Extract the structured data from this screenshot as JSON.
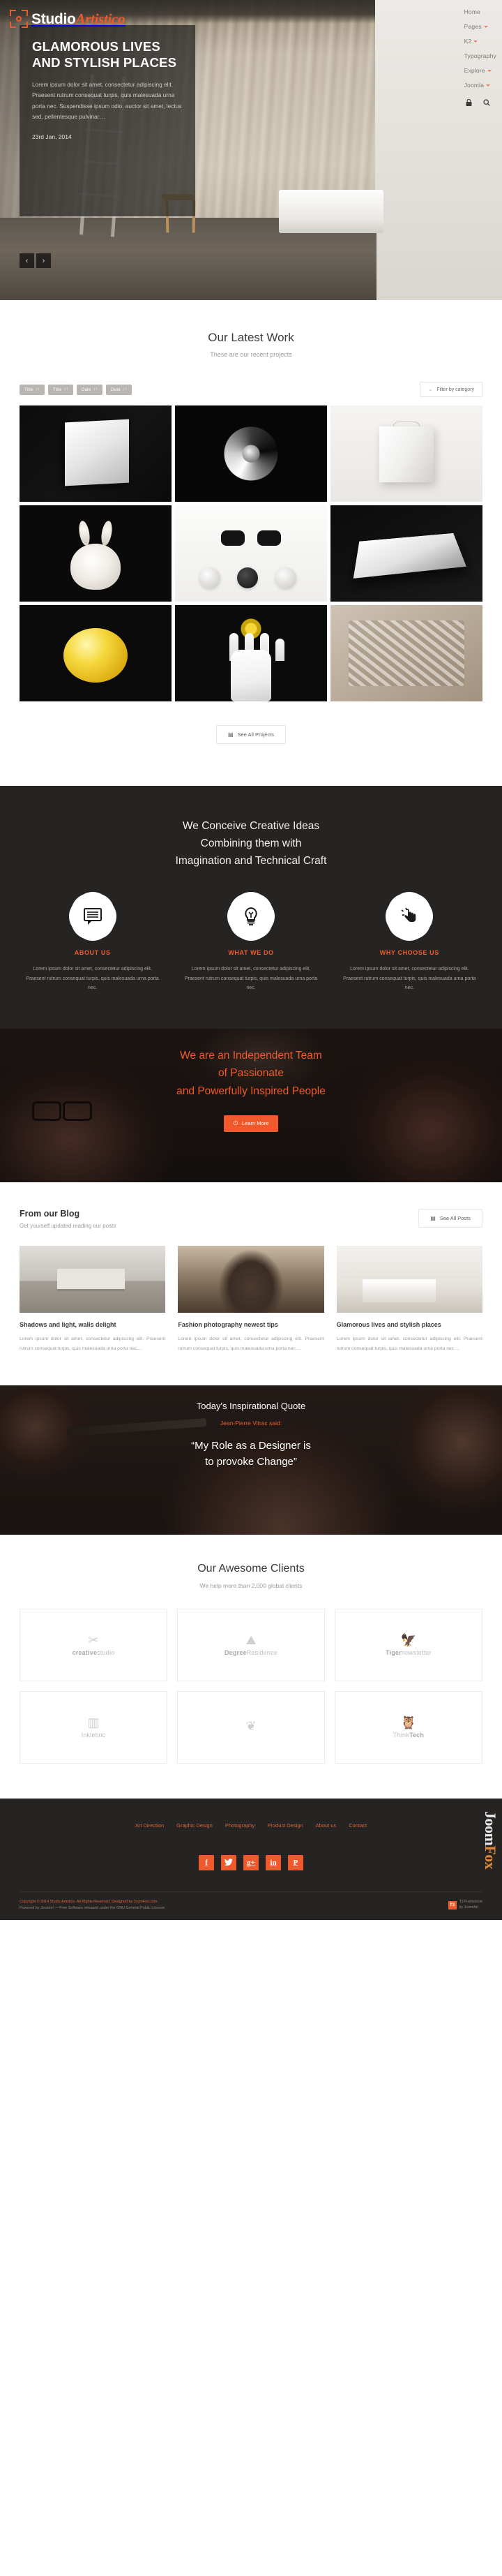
{
  "brand": {
    "name_part1": "Studio",
    "name_part2": "Artistico"
  },
  "nav": {
    "items": [
      {
        "label": "Home",
        "has_dropdown": false
      },
      {
        "label": "Pages",
        "has_dropdown": true
      },
      {
        "label": "K2",
        "has_dropdown": true
      },
      {
        "label": "Typography",
        "has_dropdown": false
      },
      {
        "label": "Explore",
        "has_dropdown": true
      },
      {
        "label": "Joomla",
        "has_dropdown": true
      }
    ],
    "icons": [
      {
        "name": "lock-icon",
        "glyph": "🔒"
      },
      {
        "name": "search-icon",
        "glyph": "🔍"
      }
    ]
  },
  "hero": {
    "title": "GLAMOROUS LIVES AND STYLISH PLACES",
    "body": "Lorem ipsum dolor sit amet, consectetur adipiscing elit. Praesent rutrum consequat turpis, quis malesuada urna porta nec. Suspendisse ipsum odio, auctor sit amet, lectus sed, pellentesque pulvinar…",
    "date": "23rd Jan, 2014",
    "prev_label": "‹",
    "next_label": "›"
  },
  "latest_work": {
    "title": "Our Latest Work",
    "subtitle": "These are our recent projects",
    "sorters": [
      {
        "label": "Title",
        "arrow": "↓↑"
      },
      {
        "label": "Title",
        "arrow": "↓↑"
      },
      {
        "label": "Date",
        "arrow": "↓↑"
      },
      {
        "label": "Date",
        "arrow": "↓↑"
      }
    ],
    "filter_label": "Filter by category",
    "see_all_label": "See All Projects",
    "tiles": [
      {
        "name": "folded-paper"
      },
      {
        "name": "spiral-shell"
      },
      {
        "name": "paper-bag"
      },
      {
        "name": "plush-bunny"
      },
      {
        "name": "glasses-lenses"
      },
      {
        "name": "open-book"
      },
      {
        "name": "yellow-lemon"
      },
      {
        "name": "hand-flower"
      },
      {
        "name": "crumpled-fabric"
      }
    ]
  },
  "ideas": {
    "heading_line1": "We Conceive Creative Ideas",
    "heading_line2": "Combining them with",
    "heading_line3": "Imagination and Technical Craft",
    "features": [
      {
        "icon": "speech-bubble-icon",
        "title": "ABOUT US",
        "body": "Lorem ipsum dolor sit amet, consectetur adipiscing elit. Praesent rutrum consequat turpis, quis malesuada urna porta nec."
      },
      {
        "icon": "lightbulb-icon",
        "title": "WHAT WE DO",
        "body": "Lorem ipsum dolor sit amet, consectetur adipiscing elit. Praesent rutrum consequat turpis, quis malesuada urna porta nec."
      },
      {
        "icon": "click-hand-icon",
        "title": "WHY CHOOSE US",
        "body": "Lorem ipsum dolor sit amet, consectetur adipiscing elit. Praesent rutrum consequat turpis, quis malesuada urna porta nec."
      }
    ]
  },
  "team_parallax": {
    "line1": "We are an Independent Team",
    "line2": "of Passionate",
    "line3": "and Powerfully Inspired People",
    "button_label": "Learn More"
  },
  "blog": {
    "title": "From our Blog",
    "subtitle": "Get yourself updated reading our posts",
    "see_all_label": "See All Posts",
    "posts": [
      {
        "title": "Shadows and light, walls delight",
        "excerpt": "Lorem ipsum dolor sit amet, consectetur adipiscing elit. Praesent rutrum consequat turpis, quis malesuada urna porta nec.…"
      },
      {
        "title": "Fashion photography newest tips",
        "excerpt": "Lorem ipsum dolor sit amet, consectetur adipiscing elit. Praesent rutrum consequat turpis, quis malesuada urna porta nec.…"
      },
      {
        "title": "Glamorous lives and stylish places",
        "excerpt": "Lorem ipsum dolor sit amet, consectetur adipiscing elit. Praesent rutrum consequat turpis, quis malesuada urna porta nec.…"
      }
    ]
  },
  "quote": {
    "title": "Today's Inspirational Quote",
    "author": "Jean-Pierre Vitrac said:",
    "text_line1": "“My Role as a Designer is",
    "text_line2": "to provoke Change”"
  },
  "clients": {
    "title": "Our Awesome Clients",
    "subtitle": "We help more than 2,000 global clients",
    "items": [
      {
        "glyph": "✂",
        "name_bold": "creative",
        "name_rest": "studio"
      },
      {
        "glyph": "⛰",
        "name_bold": "Degree",
        "name_rest": "Residence"
      },
      {
        "glyph": "🦅",
        "name_bold": "Tiger",
        "name_rest": "nowsletter"
      },
      {
        "glyph": "▥",
        "name_bold": "",
        "name_rest": "Inkletinc"
      },
      {
        "glyph": "❦",
        "name_bold": "",
        "name_rest": ""
      },
      {
        "glyph": "🦉",
        "name_bold": "Think",
        "name_rest": "Tech"
      }
    ]
  },
  "footer": {
    "links": [
      "Art Direction",
      "Graphic Design",
      "Photography",
      "Product Design",
      "About us",
      "Contact"
    ],
    "socials": [
      {
        "name": "facebook-icon",
        "glyph": "f"
      },
      {
        "name": "twitter-icon",
        "glyph": "🐦"
      },
      {
        "name": "google-plus-icon",
        "glyph": "g+"
      },
      {
        "name": "linkedin-icon",
        "glyph": "in"
      },
      {
        "name": "pinterest-icon",
        "glyph": "P"
      }
    ],
    "watermark_a": "Joom",
    "watermark_b": "Fox",
    "copyright_line1": "Copyright © 2014 Studio Artistico. All Rights Reserved. Designed by JoomFox.com",
    "copyright_line2": "Powered by Joomla! — Free Software released under the GNU General Public License.",
    "t3_label_line1": "T3 Framework",
    "t3_label_line2": "by JoomlArt"
  }
}
